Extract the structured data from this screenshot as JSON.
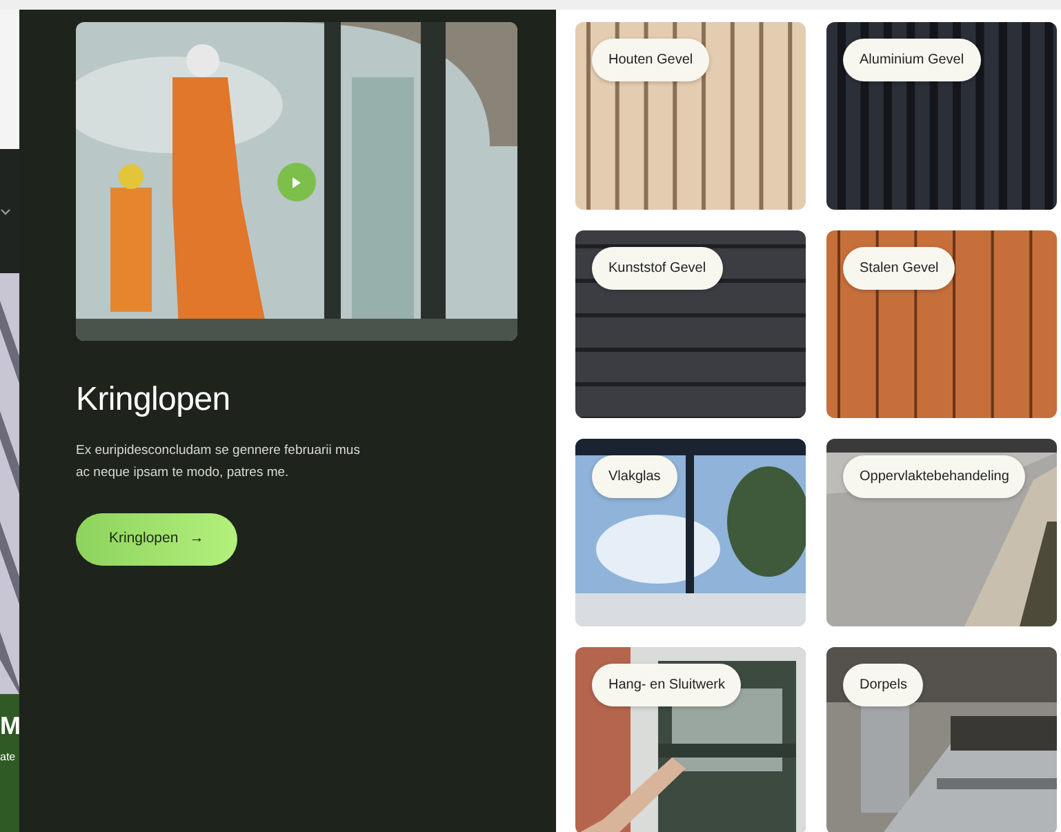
{
  "side_page": {
    "heading": "M",
    "text": "ate"
  },
  "feature": {
    "title": "Kringlopen",
    "text": "Ex euripidesconcludam se gennere februarii mus ac neque ipsam te modo, patres me.",
    "button": "Kringlopen",
    "button_icon": "→"
  },
  "categories": [
    {
      "label": "Houten Gevel"
    },
    {
      "label": "Aluminium Gevel"
    },
    {
      "label": "Kunststof Gevel"
    },
    {
      "label": "Stalen Gevel"
    },
    {
      "label": "Vlakglas"
    },
    {
      "label": "Oppervlaktebehandeling"
    },
    {
      "label": "Hang- en Sluitwerk"
    },
    {
      "label": "Dorpels"
    }
  ]
}
